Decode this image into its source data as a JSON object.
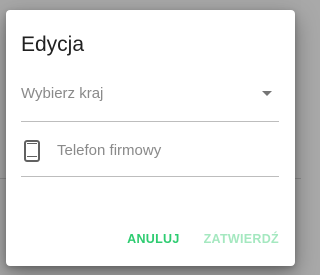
{
  "dialog": {
    "title": "Edycja",
    "country_select": {
      "placeholder": "Wybierz kraj"
    },
    "phone_field": {
      "placeholder": "Telefon firmowy",
      "value": "",
      "icon": "smartphone-icon"
    },
    "actions": {
      "cancel_label": "ANULUJ",
      "confirm_label": "ZATWIERDŹ"
    }
  },
  "colors": {
    "accent": "#2ecc71",
    "accent_disabled": "#a5e8c0",
    "backdrop": "#a8a8a8"
  }
}
